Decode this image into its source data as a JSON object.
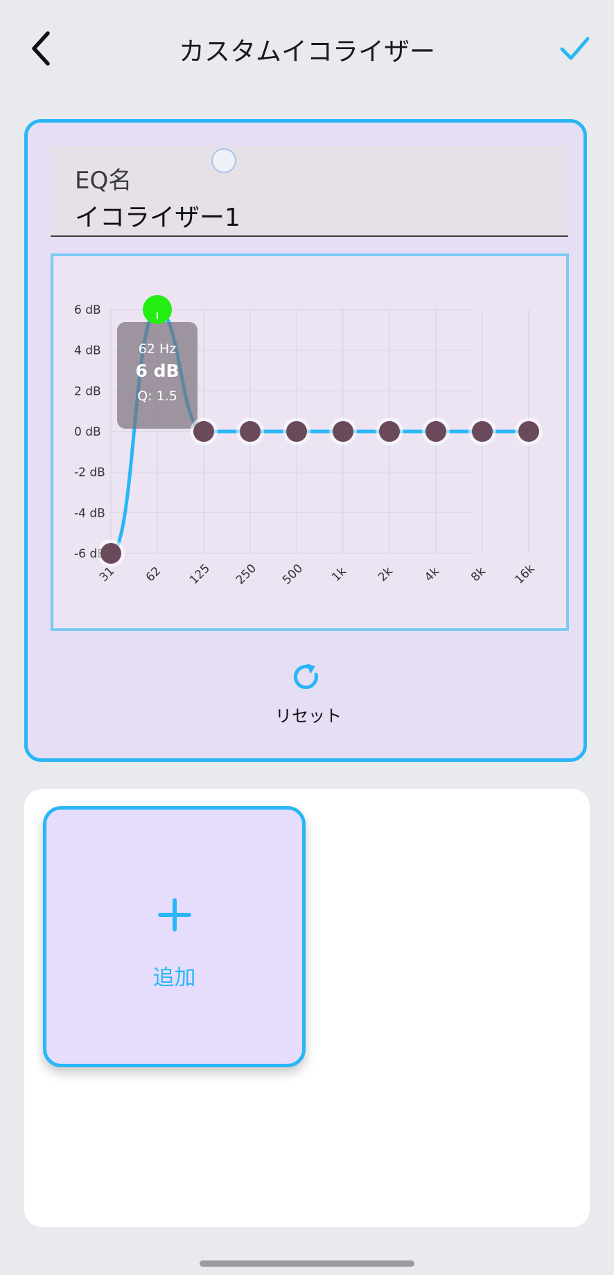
{
  "header": {
    "title": "カスタムイコライザー",
    "back_icon": "chevron-left-icon",
    "confirm_icon": "checkmark-icon"
  },
  "eq_name": {
    "label": "EQ名",
    "value": "イコライザー1"
  },
  "chart_data": {
    "type": "line",
    "x": [
      "31",
      "62",
      "125",
      "250",
      "500",
      "1k",
      "2k",
      "4k",
      "8k",
      "16k"
    ],
    "y_ticks": [
      "6 dB",
      "4 dB",
      "2 dB",
      "0 dB",
      "-2 dB",
      "-4 dB",
      "-6 dB"
    ],
    "ylim": [
      -6,
      6
    ],
    "series": [
      {
        "values": [
          -6,
          6,
          0,
          0,
          0,
          0,
          0,
          0,
          0,
          0
        ]
      }
    ],
    "selected_index": 1,
    "tooltip": {
      "freq": "62 Hz",
      "gain": "6 dB",
      "q": "Q: 1.5"
    },
    "line_color": "#29b6f6",
    "point_color": "#6a4a5a",
    "selected_point_color": "#22ee11",
    "grid": true
  },
  "reset": {
    "label": "リセット",
    "icon": "refresh-icon"
  },
  "presets": {
    "add_label": "追加",
    "add_icon": "plus-icon"
  },
  "colors": {
    "accent": "#29b6f6",
    "card_bg": "#e5def5",
    "add_tile_bg": "#e6ddfd"
  }
}
